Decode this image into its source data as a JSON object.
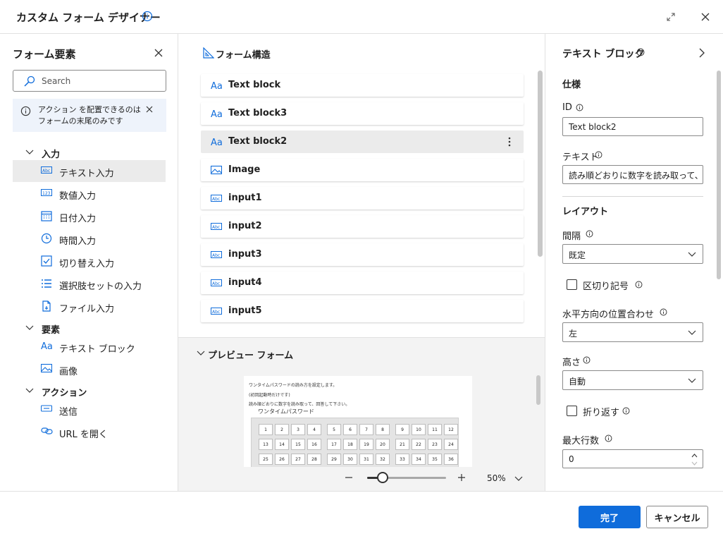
{
  "window": {
    "title": "カスタム フォーム デザイナー"
  },
  "left_panel": {
    "title": "フォーム要素",
    "search_placeholder": "Search",
    "notice": "アクション を配置できるのはフォームの末尾のみです",
    "groups": [
      {
        "label": "入力",
        "items": [
          {
            "label": "テキスト入力",
            "icon": "text-input-icon",
            "selected": true
          },
          {
            "label": "数値入力",
            "icon": "number-input-icon"
          },
          {
            "label": "日付入力",
            "icon": "calendar-icon"
          },
          {
            "label": "時間入力",
            "icon": "clock-icon"
          },
          {
            "label": "切り替え入力",
            "icon": "checkbox-icon"
          },
          {
            "label": "選択肢セットの入力",
            "icon": "list-icon"
          },
          {
            "label": "ファイル入力",
            "icon": "file-icon"
          }
        ]
      },
      {
        "label": "要素",
        "items": [
          {
            "label": "テキスト ブロック",
            "icon": "text-block-icon"
          },
          {
            "label": "画像",
            "icon": "image-icon"
          }
        ]
      },
      {
        "label": "アクション",
        "items": [
          {
            "label": "送信",
            "icon": "submit-icon"
          },
          {
            "label": "URL を開く",
            "icon": "link-icon"
          }
        ]
      }
    ]
  },
  "structure": {
    "title": "フォーム構造",
    "items": [
      {
        "label": "Text block",
        "icon": "text-block-icon"
      },
      {
        "label": "Text block3",
        "icon": "text-block-icon"
      },
      {
        "label": "Text block2",
        "icon": "text-block-icon",
        "selected": true
      },
      {
        "label": "Image",
        "icon": "image-icon"
      },
      {
        "label": "input1",
        "icon": "text-input-icon"
      },
      {
        "label": "input2",
        "icon": "text-input-icon"
      },
      {
        "label": "input3",
        "icon": "text-input-icon"
      },
      {
        "label": "input4",
        "icon": "text-input-icon"
      },
      {
        "label": "input5",
        "icon": "text-input-icon"
      }
    ]
  },
  "preview": {
    "title": "プレビュー フォーム",
    "lines": [
      "ワンタイムパスワードの読み方を設定します。",
      "(初回起動時だけです)",
      "読み順どおりに数字を読み取って、回答して下さい。",
      "ワンタイムパスワード"
    ],
    "zoom_value": "50%",
    "zoom_fraction": 0.2,
    "grid_numbers": [
      [
        1,
        2,
        3,
        4,
        5,
        6,
        7,
        8,
        9,
        10,
        11,
        12
      ],
      [
        13,
        14,
        15,
        16,
        17,
        18,
        19,
        20,
        21,
        22,
        23,
        24
      ],
      [
        25,
        26,
        27,
        28,
        29,
        30,
        31,
        32,
        33,
        34,
        35,
        36
      ]
    ]
  },
  "properties": {
    "title": "テキスト ブロック",
    "spec_heading": "仕様",
    "id_label": "ID",
    "id_value": "Text block2",
    "text_label": "テキスト",
    "text_value": "読み順どおりに数字を読み取って、回{x}",
    "layout_heading": "レイアウト",
    "spacing_label": "間隔",
    "spacing_value": "既定",
    "separator_label": "区切り記号",
    "separator_checked": false,
    "halign_label": "水平方向の位置合わせ",
    "halign_value": "左",
    "height_label": "高さ",
    "height_value": "自動",
    "wrap_label": "折り返す",
    "wrap_checked": false,
    "maxlines_label": "最大行数",
    "maxlines_value": "0"
  },
  "footer": {
    "done_label": "完了",
    "cancel_label": "キャンセル"
  },
  "colors": {
    "accent": "#0f6cdb",
    "icon_blue": "#0f6cdb",
    "selected_bg": "#ebebeb"
  }
}
